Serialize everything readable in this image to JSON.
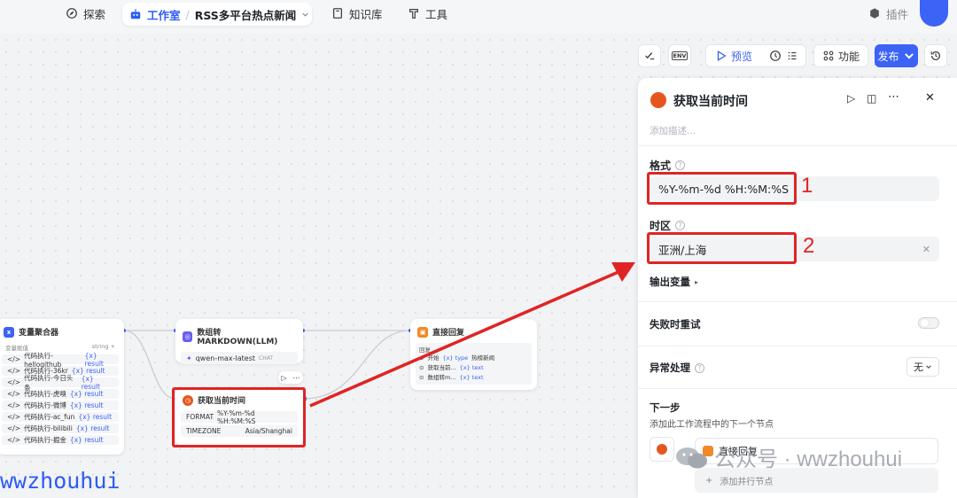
{
  "nav": {
    "explore": "探索",
    "workspace": "工作室",
    "separator": "/",
    "app_name": "RSS多平台热点新闻",
    "knowledge": "知识库",
    "tools": "工具",
    "plugins": "插件"
  },
  "toolbar": {
    "env": "ENV",
    "preview": "预览",
    "features": "功能",
    "publish": "发布"
  },
  "nodes": {
    "aggregator": {
      "title": "变量聚合器",
      "group_label": "变量赋值",
      "type": "string",
      "rows": [
        {
          "name": "代码执行-hellogithub",
          "ref": "result"
        },
        {
          "name": "代码执行-36kr",
          "ref": "result"
        },
        {
          "name": "代码执行-今日头条",
          "ref": "result"
        },
        {
          "name": "代码执行-虎嗅",
          "ref": "result"
        },
        {
          "name": "代码执行-微博",
          "ref": "result"
        },
        {
          "name": "代码执行-ac_fun",
          "ref": "result"
        },
        {
          "name": "代码执行-bilibili",
          "ref": "result"
        },
        {
          "name": "代码执行-掘金",
          "ref": "result"
        }
      ]
    },
    "llm": {
      "title": "数组转MARKDOWN(LLM)",
      "model": "qwen-max-latest",
      "mode": "CHAT"
    },
    "time": {
      "title": "获取当前时间",
      "format_key": "FORMAT",
      "format_val": "%Y-%m-%d %H:%M:%S",
      "tz_key": "TIMEZONE",
      "tz_val": "Asia/Shanghai"
    },
    "reply": {
      "title": "直接回复",
      "section": "回复",
      "rows": [
        {
          "src": "开始",
          "ref": "type",
          "extra": "热榜新闻"
        },
        {
          "src": "获取当前...",
          "ref": "text",
          "extra": ""
        },
        {
          "src": "数组转m...",
          "ref": "text",
          "extra": ""
        }
      ]
    }
  },
  "panel": {
    "title": "获取当前时间",
    "description_placeholder": "添加描述...",
    "format_label": "格式",
    "format_value": "%Y-%m-%d %H:%M:%S",
    "timezone_label": "时区",
    "timezone_value": "亚洲/上海",
    "output_label": "输出变量",
    "retry_label": "失败时重试",
    "error_label": "异常处理",
    "error_value": "无",
    "next_label": "下一步",
    "next_desc": "添加此工作流程中的下一个节点",
    "next_node": "直接回复",
    "add_parallel": "添加并行节点"
  },
  "annotations": {
    "one": "1",
    "two": "2",
    "watermark": "公众号 · wwzhouhui",
    "handle": "wwzhouhui"
  },
  "colors": {
    "accent": "#3b63f6",
    "highlight": "#e02424",
    "time_icon": "#e5561f",
    "reply_icon": "#f08a24"
  }
}
